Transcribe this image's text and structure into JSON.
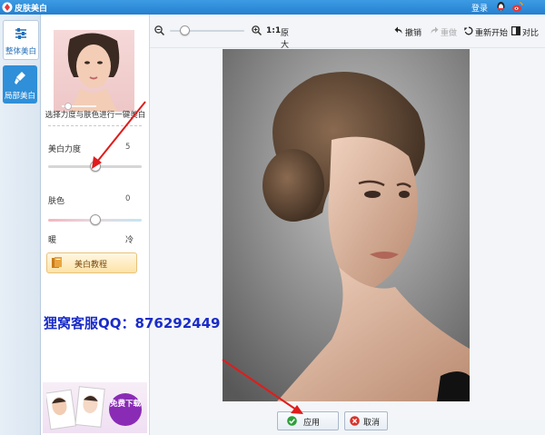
{
  "window": {
    "title": "皮肤美白",
    "login": "登录"
  },
  "left_tabs": [
    {
      "label": "整体美白",
      "icon": "sliders-icon",
      "active": true
    },
    {
      "label": "局部美白",
      "icon": "brush-icon",
      "active": false
    }
  ],
  "panel": {
    "hint": "选择力度与肤色进行一键美白",
    "strength": {
      "label": "美白力度",
      "value": "5",
      "level": 0.5
    },
    "tone": {
      "label": "肤色",
      "value": "0",
      "level": 0.5,
      "left_label": "暖",
      "right_label": "冷"
    },
    "tutorial_label": "美白教程",
    "ad_text": "免费下载"
  },
  "toolbar": {
    "zoom_ratio": "1:1",
    "original_label": "原大",
    "undo_label": "撤销",
    "redo_label": "重做",
    "restart_label": "重新开始",
    "compare_label": "对比",
    "zoom_level": 0.2
  },
  "buttons": {
    "apply_label": "应用",
    "cancel_label": "取消"
  },
  "watermark": "狸窝客服QQ：876292449",
  "colors": {
    "accent": "#2f8fd8",
    "arrow": "#e01c1c",
    "watermark": "#1a2cc9"
  }
}
